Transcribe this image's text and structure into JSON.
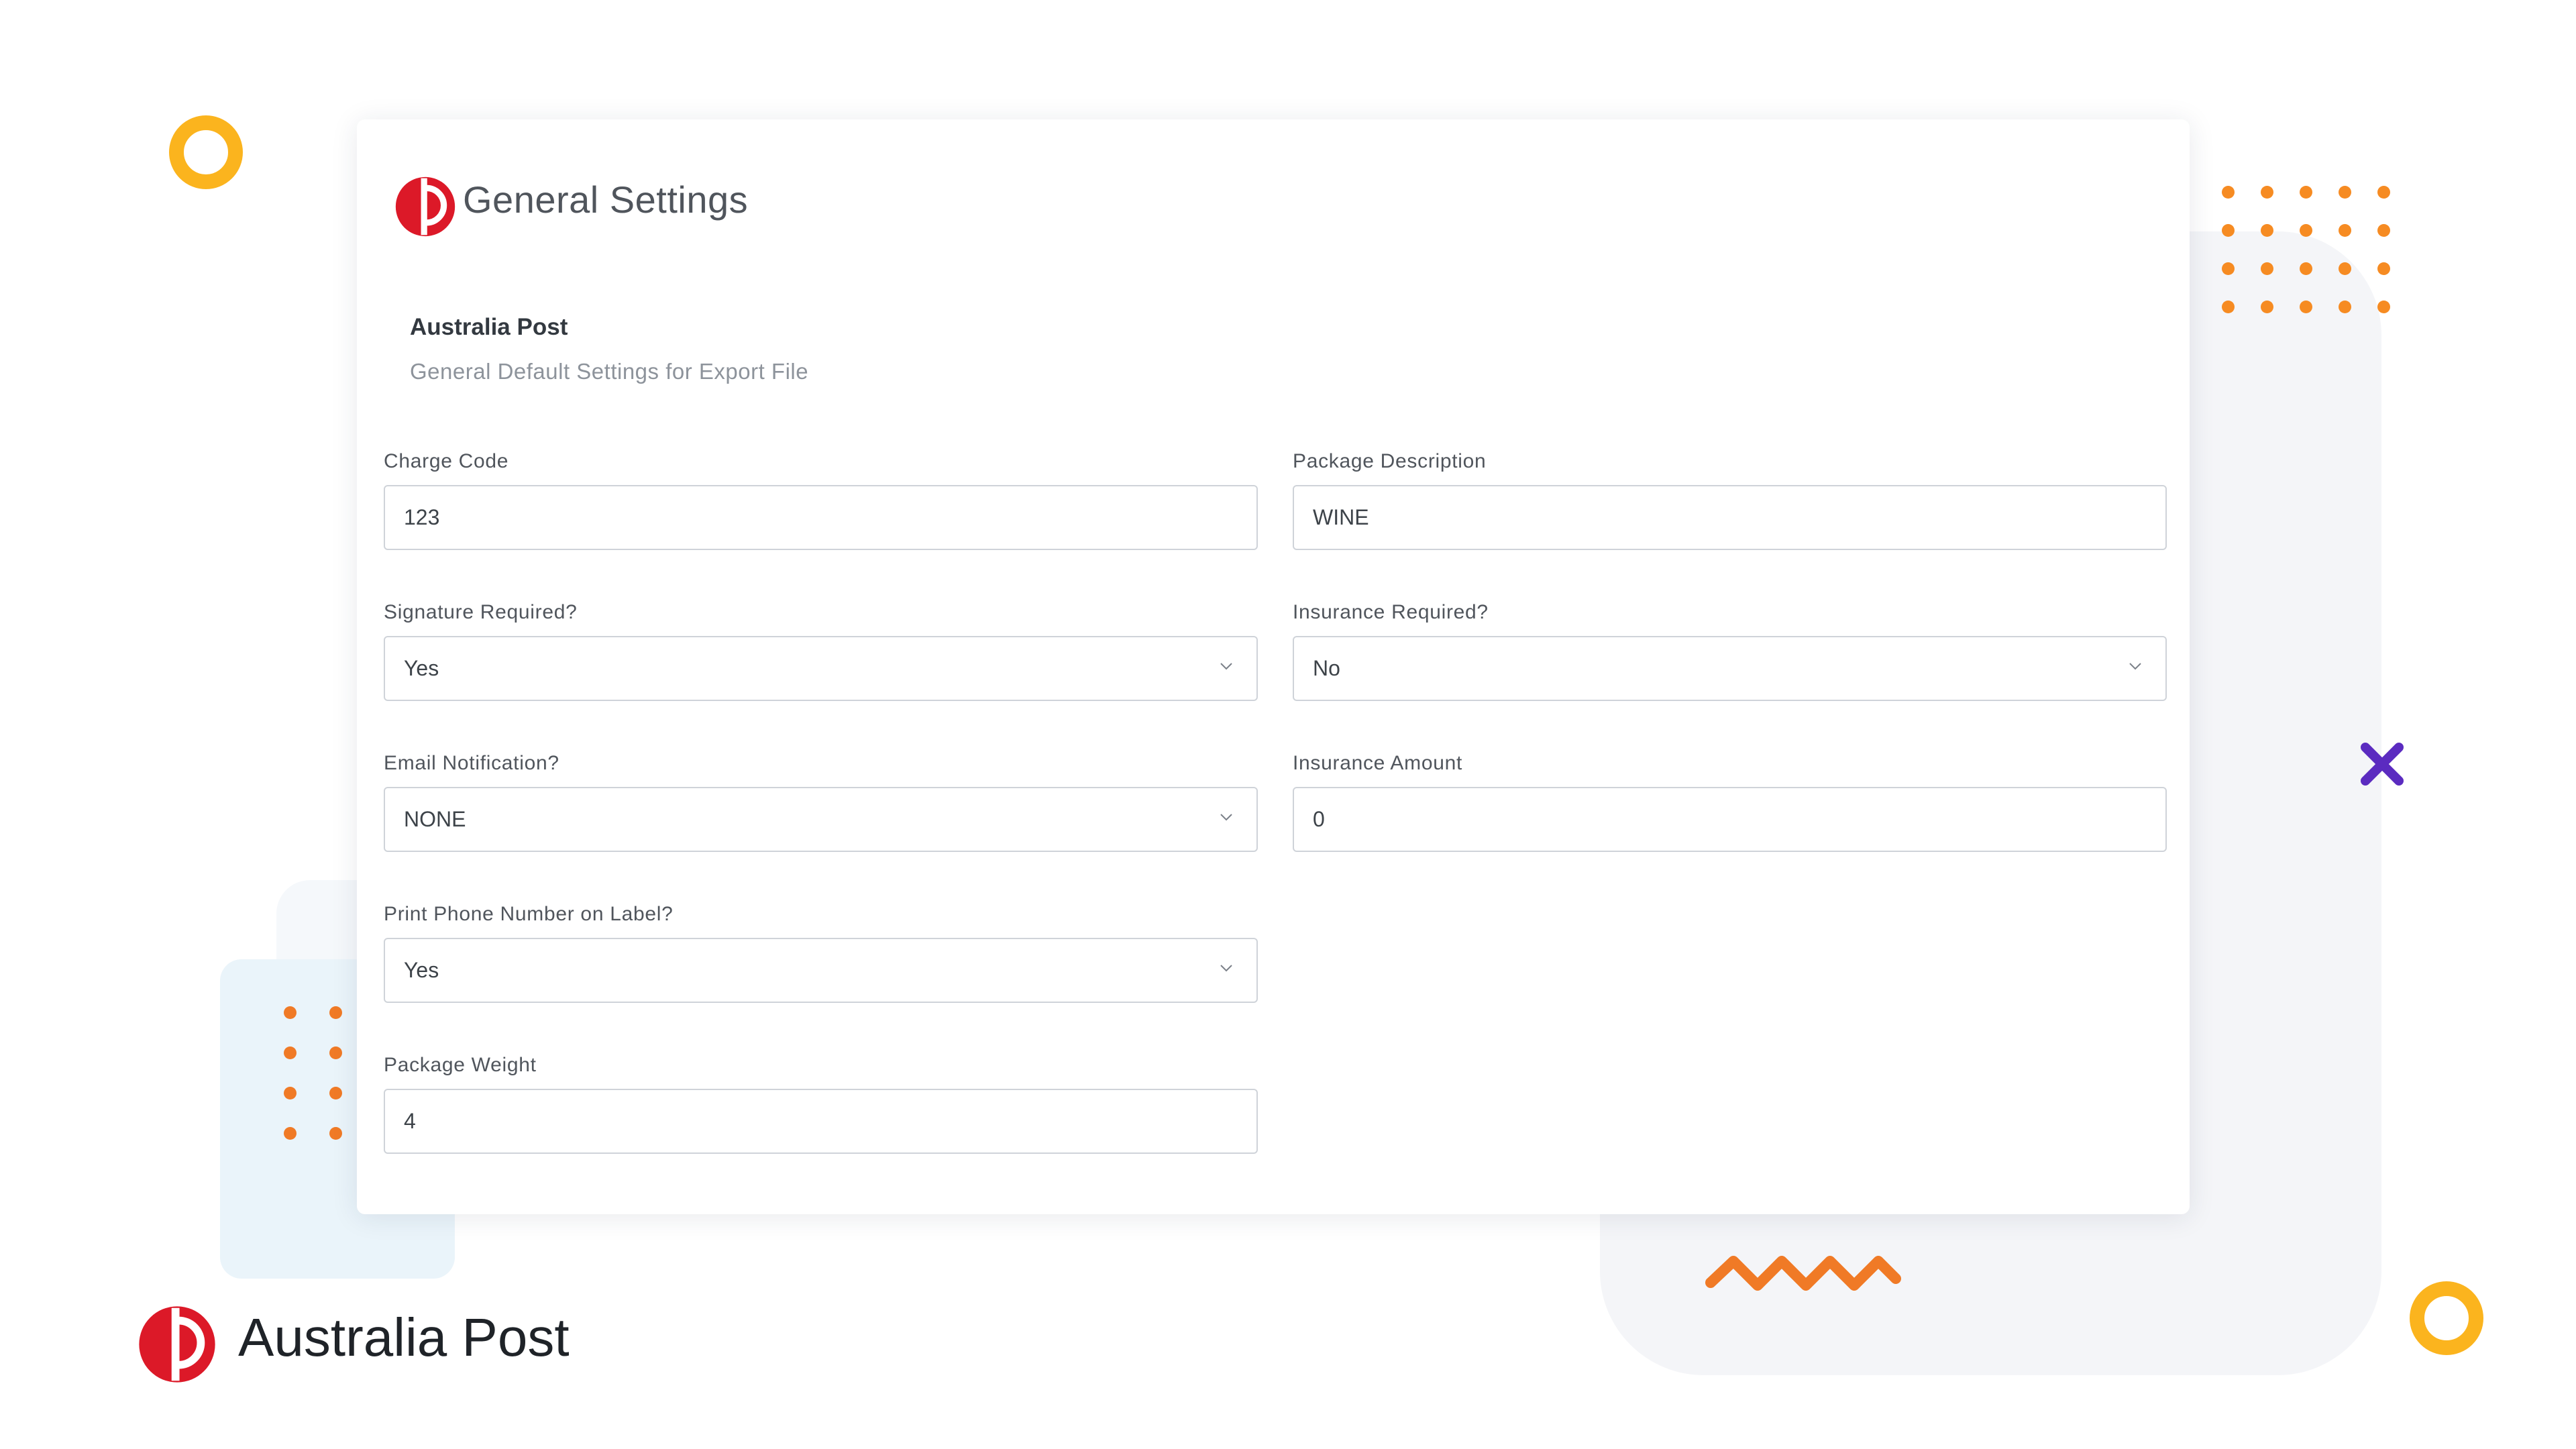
{
  "colors": {
    "accent_yellow": "#fbb41e",
    "accent_orange": "#f68b22",
    "accent_purple": "#5b2bc0",
    "brand_red": "#dc1928"
  },
  "header": {
    "title": "General Settings",
    "logo_icon": "australia-post-logo-icon"
  },
  "section": {
    "heading": "Australia Post",
    "subheading": "General Default Settings for Export File"
  },
  "fields": {
    "charge_code": {
      "label": "Charge Code",
      "value": "123"
    },
    "package_description": {
      "label": "Package Description",
      "value": "WINE"
    },
    "signature_required": {
      "label": "Signature Required?",
      "value": "Yes"
    },
    "insurance_required": {
      "label": "Insurance Required?",
      "value": "No"
    },
    "email_notification": {
      "label": "Email Notification?",
      "value": "NONE"
    },
    "insurance_amount": {
      "label": "Insurance Amount",
      "value": "0"
    },
    "print_phone_number": {
      "label": "Print Phone Number on Label?",
      "value": "Yes"
    },
    "package_weight": {
      "label": "Package Weight",
      "value": "4"
    }
  },
  "brand": {
    "name": "Australia Post",
    "logo_icon": "australia-post-logo-icon"
  }
}
